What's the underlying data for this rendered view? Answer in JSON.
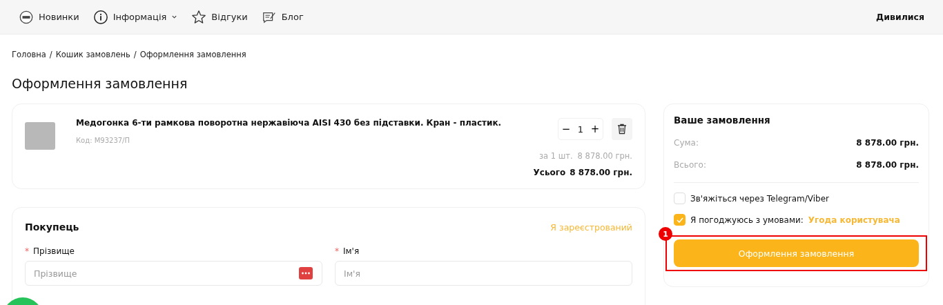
{
  "nav": {
    "items": [
      {
        "label": "Новинки",
        "dropdown": false
      },
      {
        "label": "Інформація",
        "dropdown": true
      },
      {
        "label": "Відгуки",
        "dropdown": false
      },
      {
        "label": "Блог",
        "dropdown": false
      }
    ],
    "right_link": "Дивилися"
  },
  "breadcrumbs": [
    {
      "label": "Головна"
    },
    {
      "separator": "/",
      "label": "Кошик замовлень"
    },
    {
      "separator": "/",
      "label": "Оформлення замовлення"
    }
  ],
  "page_title": "Оформлення замовлення",
  "cart_item": {
    "name": "Медогонка 6-ти рамкова поворотна нержавіюча AISI 430 без підставки. Кран - пластик.",
    "code": "Код: М93237/П",
    "quantity": "1",
    "minus": "−",
    "plus": "+",
    "unit_price_label": "за 1 шт.",
    "unit_price": "8 878.00 грн.",
    "total_label": "Усього",
    "total": "8 878.00 грн."
  },
  "buyer": {
    "title": "Покупець",
    "registered_link": "Я зареєстрований",
    "fields": [
      {
        "label": "Прізвище",
        "placeholder": "Прізвище",
        "required_mark": "*",
        "password_icon": true
      },
      {
        "label": "Ім'я",
        "placeholder": "Ім'я",
        "required_mark": "*",
        "password_icon": false
      }
    ]
  },
  "summary": {
    "title": "Ваше замовлення",
    "rows": [
      {
        "label": "Сума:",
        "value": "8 878.00 грн."
      },
      {
        "label": "Всього:",
        "value": "8 878.00 грн."
      }
    ],
    "options": [
      {
        "label": "Зв'яжіться через Telegram/Viber",
        "checked": false
      },
      {
        "label": "Я погоджуюсь з умовами:",
        "link": "Угода користувача",
        "checked": true
      }
    ],
    "submit": "Оформлення замовлення",
    "highlight_badge": "1"
  }
}
